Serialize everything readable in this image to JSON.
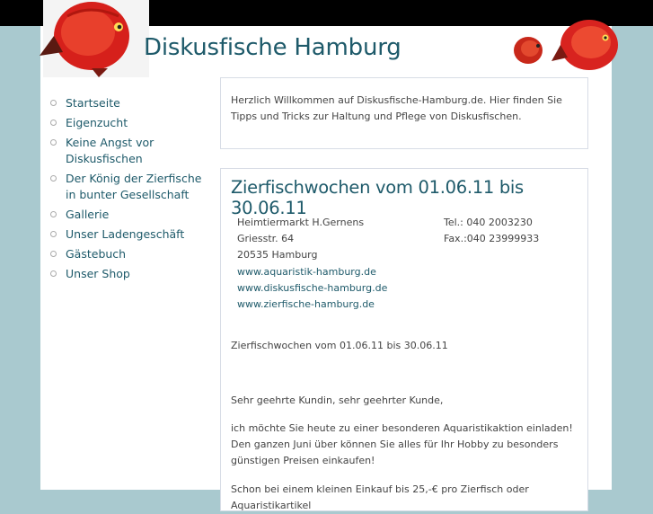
{
  "header": {
    "title": "Diskusfische Hamburg"
  },
  "nav": {
    "items": [
      {
        "label": "Startseite"
      },
      {
        "label": "Eigenzucht"
      },
      {
        "label": "Keine Angst vor Diskusfischen"
      },
      {
        "label": "Der König der Zierfische in bunter Gesellschaft"
      },
      {
        "label": "Gallerie"
      },
      {
        "label": "Unser Ladengeschäft"
      },
      {
        "label": "Gästebuch"
      },
      {
        "label": "Unser Shop"
      }
    ]
  },
  "intro": {
    "text": "Herzlich Willkommen auf Diskusfische-Hamburg.de. Hier finden Sie Tipps und Tricks zur Haltung und Pflege von Diskusfischen."
  },
  "article": {
    "title": "Zierfischwochen vom 01.06.11 bis 30.06.11",
    "address": {
      "line1": "Heimtiermarkt  H.Gernens",
      "line2": "Griesstr. 64",
      "line3": "20535 Hamburg",
      "link1": "www.aquaristik-hamburg.de",
      "link2": "www.diskusfische-hamburg.de",
      "link3": "www.zierfische-hamburg.de"
    },
    "contact": {
      "tel": "Tel.: 040 2003230",
      "fax": "Fax.:040 23999933"
    },
    "p1": "Zierfischwochen vom 01.06.11 bis 30.06.11",
    "p2": "Sehr geehrte Kundin, sehr geehrter Kunde,",
    "p3a": "ich möchte Sie heute zu einer besonderen Aquaristikaktion einladen!",
    "p3b": "Den ganzen Juni über können Sie alles für Ihr Hobby zu besonders günstigen Preisen einkaufen!",
    "p4": "Schon bei einem kleinen Einkauf bis 25,-€ pro Zierfisch oder Aquaristikartikel"
  },
  "colors": {
    "accent": "#1e5a6a",
    "background": "#a9c9cf",
    "fish": "#d8231f"
  }
}
